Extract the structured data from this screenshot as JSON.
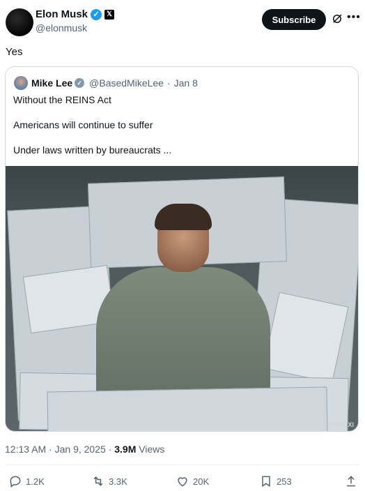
{
  "author": {
    "name": "Elon Musk",
    "handle": "@elonmusk",
    "verified": true
  },
  "subscribe_label": "Subscribe",
  "tweet_text": "Yes",
  "quote": {
    "name": "Mike Lee",
    "handle": "@BasedMikeLee",
    "date": "Jan 8",
    "lines": [
      "Without the REINS Act",
      "Americans will continue to suffer",
      "Under laws written by bureaucrats ..."
    ],
    "image_watermark": "GROK Xl"
  },
  "meta": {
    "time": "12:13 AM",
    "date": "Jan 9, 2025",
    "views": "3.9M",
    "views_label": "Views"
  },
  "actions": {
    "replies": "1.2K",
    "reposts": "3.3K",
    "likes": "20K",
    "bookmarks": "253"
  },
  "colors": {
    "accent": "#1d9bf0",
    "text": "#0f1419",
    "secondary": "#536471"
  }
}
